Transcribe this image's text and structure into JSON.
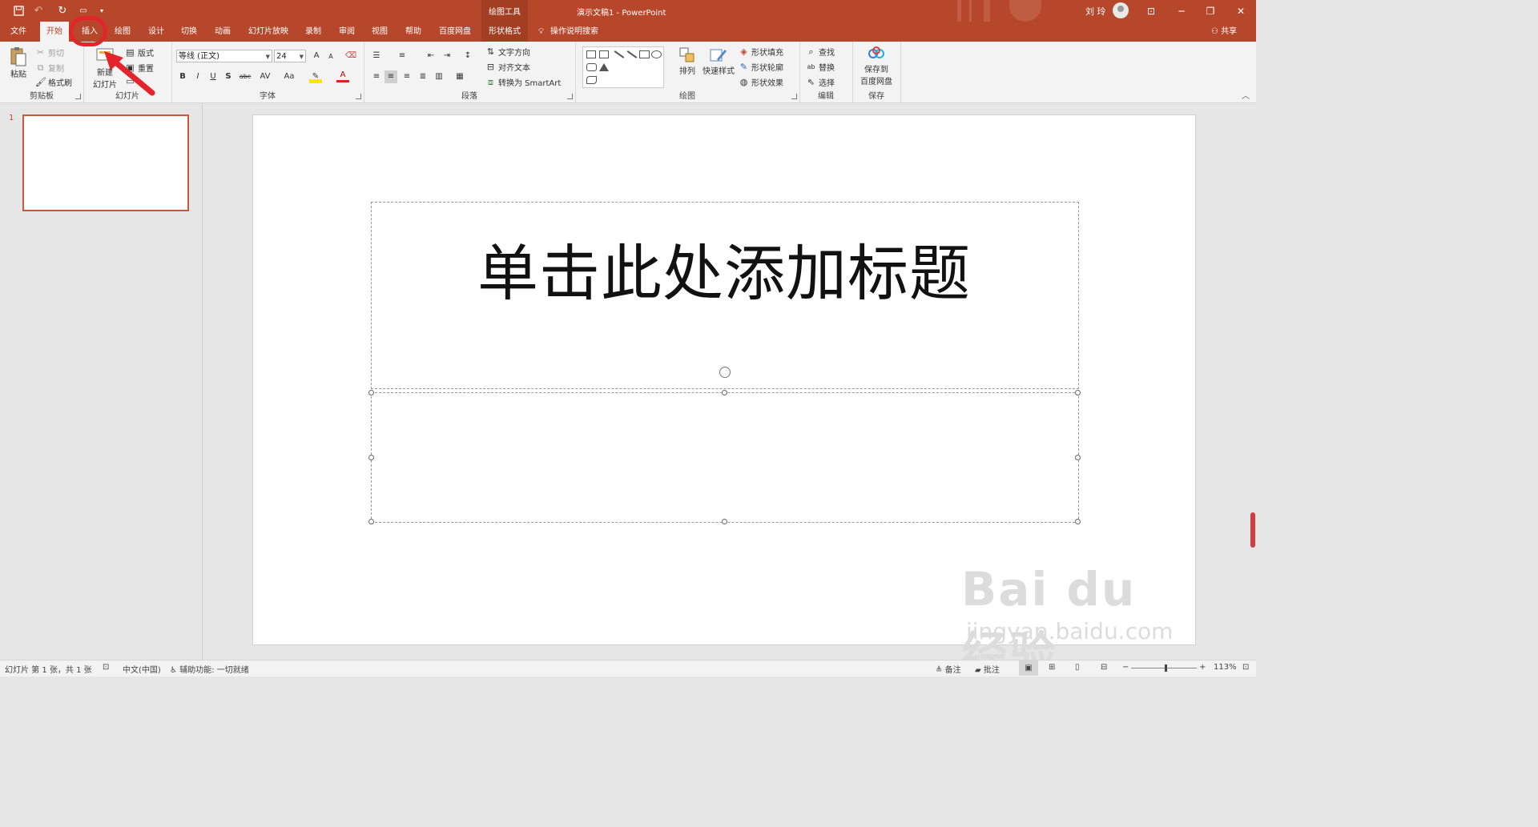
{
  "titlebar": {
    "context_tab": "绘图工具",
    "title": "演示文稿1  -  PowerPoint",
    "user": "刘 玲",
    "quick_access": [
      "save-icon",
      "undo-icon",
      "redo-icon",
      "present-icon",
      "customize-icon"
    ]
  },
  "tabs": {
    "items": [
      "文件",
      "开始",
      "插入",
      "绘图",
      "设计",
      "切换",
      "动画",
      "幻灯片放映",
      "录制",
      "审阅",
      "视图",
      "帮助",
      "百度网盘",
      "形状格式"
    ],
    "active": "开始",
    "highlighted": "插入",
    "search": "操作说明搜索",
    "share": "共享"
  },
  "ribbon": {
    "clipboard": {
      "label": "剪贴板",
      "paste": "粘贴",
      "cut": "剪切",
      "copy": "复制",
      "format_painter": "格式刷"
    },
    "slides": {
      "label": "幻灯片",
      "new_slide_1": "新建",
      "new_slide_2": "幻灯片",
      "layout": "版式",
      "reset": "重置"
    },
    "font": {
      "label": "字体",
      "font_name": "等线 (正文)",
      "font_size": "24",
      "grow": "A",
      "shrink": "A",
      "bold": "B",
      "italic": "I",
      "underline": "U",
      "shadow": "S",
      "strike": "abc",
      "spacing": "AV",
      "case": "Aa",
      "color": "A"
    },
    "paragraph": {
      "label": "段落",
      "text_direction": "文字方向",
      "align_text": "对齐文本",
      "smartart": "转换为 SmartArt"
    },
    "drawing": {
      "label": "绘图",
      "arrange": "排列",
      "quick_styles": "快速样式",
      "fill": "形状填充",
      "outline": "形状轮廓",
      "effects": "形状效果"
    },
    "editing": {
      "label": "编辑",
      "find": "查找",
      "replace": "替换",
      "select": "选择"
    },
    "save": {
      "label": "保存",
      "save_to_1": "保存到",
      "save_to_2": "百度网盘"
    }
  },
  "thumbs": {
    "slide_number": "1"
  },
  "slide": {
    "title_placeholder": "单击此处添加标题"
  },
  "watermark": {
    "brand": "Bai du 经验",
    "url": "jingyan.baidu.com"
  },
  "status": {
    "slide_info": "幻灯片 第 1 张，共 1 张",
    "language": "中文(中国)",
    "accessibility": "辅助功能: 一切就绪",
    "notes": "备注",
    "comments": "批注",
    "zoom": "113%",
    "zoom_minus": "−",
    "zoom_plus": "+"
  },
  "colors": {
    "accent": "#b7472a",
    "annotation": "#e3242b"
  }
}
